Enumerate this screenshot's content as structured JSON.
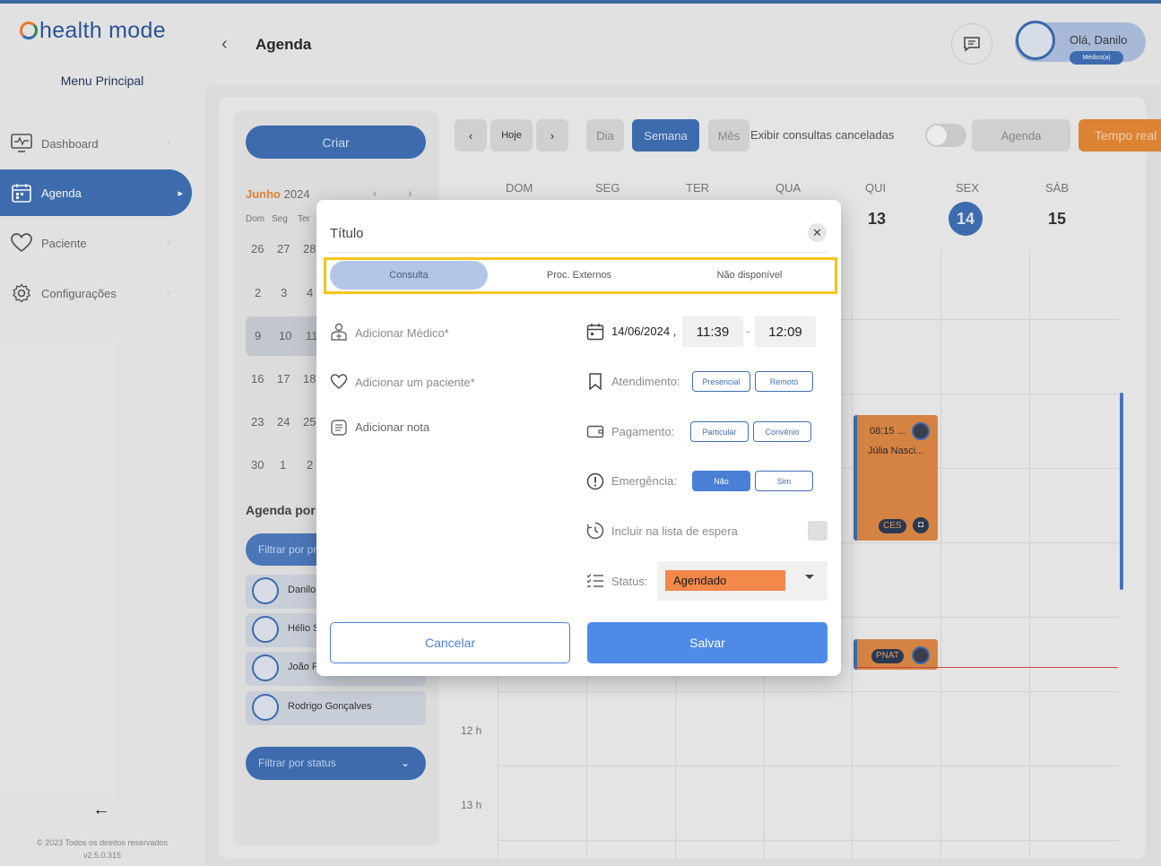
{
  "app": {
    "brand": "health mode",
    "menu_title": "Menu Principal",
    "copyright": "© 2023 Todos os direitos reservados",
    "version": "v2.5.0.315"
  },
  "sidebar": {
    "items": [
      {
        "label": "Dashboard",
        "icon": "dashboard-monitor-icon",
        "active": false
      },
      {
        "label": "Agenda",
        "icon": "calendar-icon",
        "active": true
      },
      {
        "label": "Paciente",
        "icon": "heart-icon",
        "active": false
      },
      {
        "label": "Configurações",
        "icon": "gear-icon",
        "active": false
      }
    ]
  },
  "header": {
    "title": "Agenda",
    "greeting": "Olá, Danilo",
    "role": "Médico(a)"
  },
  "left_panel": {
    "create_label": "Criar",
    "month": "Junho",
    "year": "2024",
    "weekdays": [
      "Dom",
      "Seg",
      "Ter"
    ],
    "rows": [
      [
        "26",
        "27",
        "28"
      ],
      [
        "2",
        "3",
        "4"
      ],
      [
        "9",
        "10",
        "11"
      ],
      [
        "16",
        "17",
        "18"
      ],
      [
        "23",
        "24",
        "25"
      ],
      [
        "30",
        "1",
        "2"
      ]
    ],
    "agenda_por_label": "Agenda por",
    "filter_professional_placeholder": "Filtrar por pr",
    "doctors": [
      "Danilo",
      "Hélio S",
      "João F",
      "Rodrigo Gonçalves"
    ],
    "filter_status_label": "Filtrar por status"
  },
  "toolbar": {
    "today": "Hoje",
    "views": [
      "Dia",
      "Semana",
      "Mês"
    ],
    "active_view": "Semana",
    "show_cancelled_label": "Exibir consultas canceladas",
    "agenda_btn": "Agenda",
    "realtime_btn": "Tempo real"
  },
  "week": {
    "days": [
      "DOM",
      "SEG",
      "TER",
      "QUA",
      "QUI",
      "SEX",
      "SÁB"
    ],
    "visible_numbers": {
      "QUI": "13",
      "SEX": "14",
      "SÁB": "15"
    },
    "today": "14",
    "hours": [
      "12 h",
      "13 h"
    ]
  },
  "events": [
    {
      "time": "08:15 ...",
      "name": "Júlia Nasci...",
      "badge": "CES"
    },
    {
      "badge": "PNAT"
    }
  ],
  "modal": {
    "title": "Título",
    "tabs": [
      "Consulta",
      "Proc. Externos",
      "Não disponível"
    ],
    "active_tab": "Consulta",
    "add_doctor": "Adicionar Médico*",
    "add_patient": "Adicionar um paciente*",
    "add_note": "Adicionar nota",
    "date": "14/06/2024",
    "start_time": "11:39",
    "end_time": "12:09",
    "attendance_label": "Atendimento:",
    "attendance_options": [
      "Presencial",
      "Remoto"
    ],
    "payment_label": "Pagamento:",
    "payment_options": [
      "Particular",
      "Convênio"
    ],
    "emergency_label": "Emergência:",
    "emergency_options": [
      "Não",
      "Sim"
    ],
    "emergency_selected": "Não",
    "waitlist_label": "Incluir na lista de espera",
    "status_label": "Status:",
    "status_value": "Agendado",
    "cancel_label": "Cancelar",
    "save_label": "Salvar"
  },
  "colors": {
    "primary": "#3f6fb3",
    "accent_orange": "#e48836",
    "save_blue": "#4f8ae6",
    "highlight_yellow": "#f5c518",
    "now_line": "#d24b4b"
  }
}
